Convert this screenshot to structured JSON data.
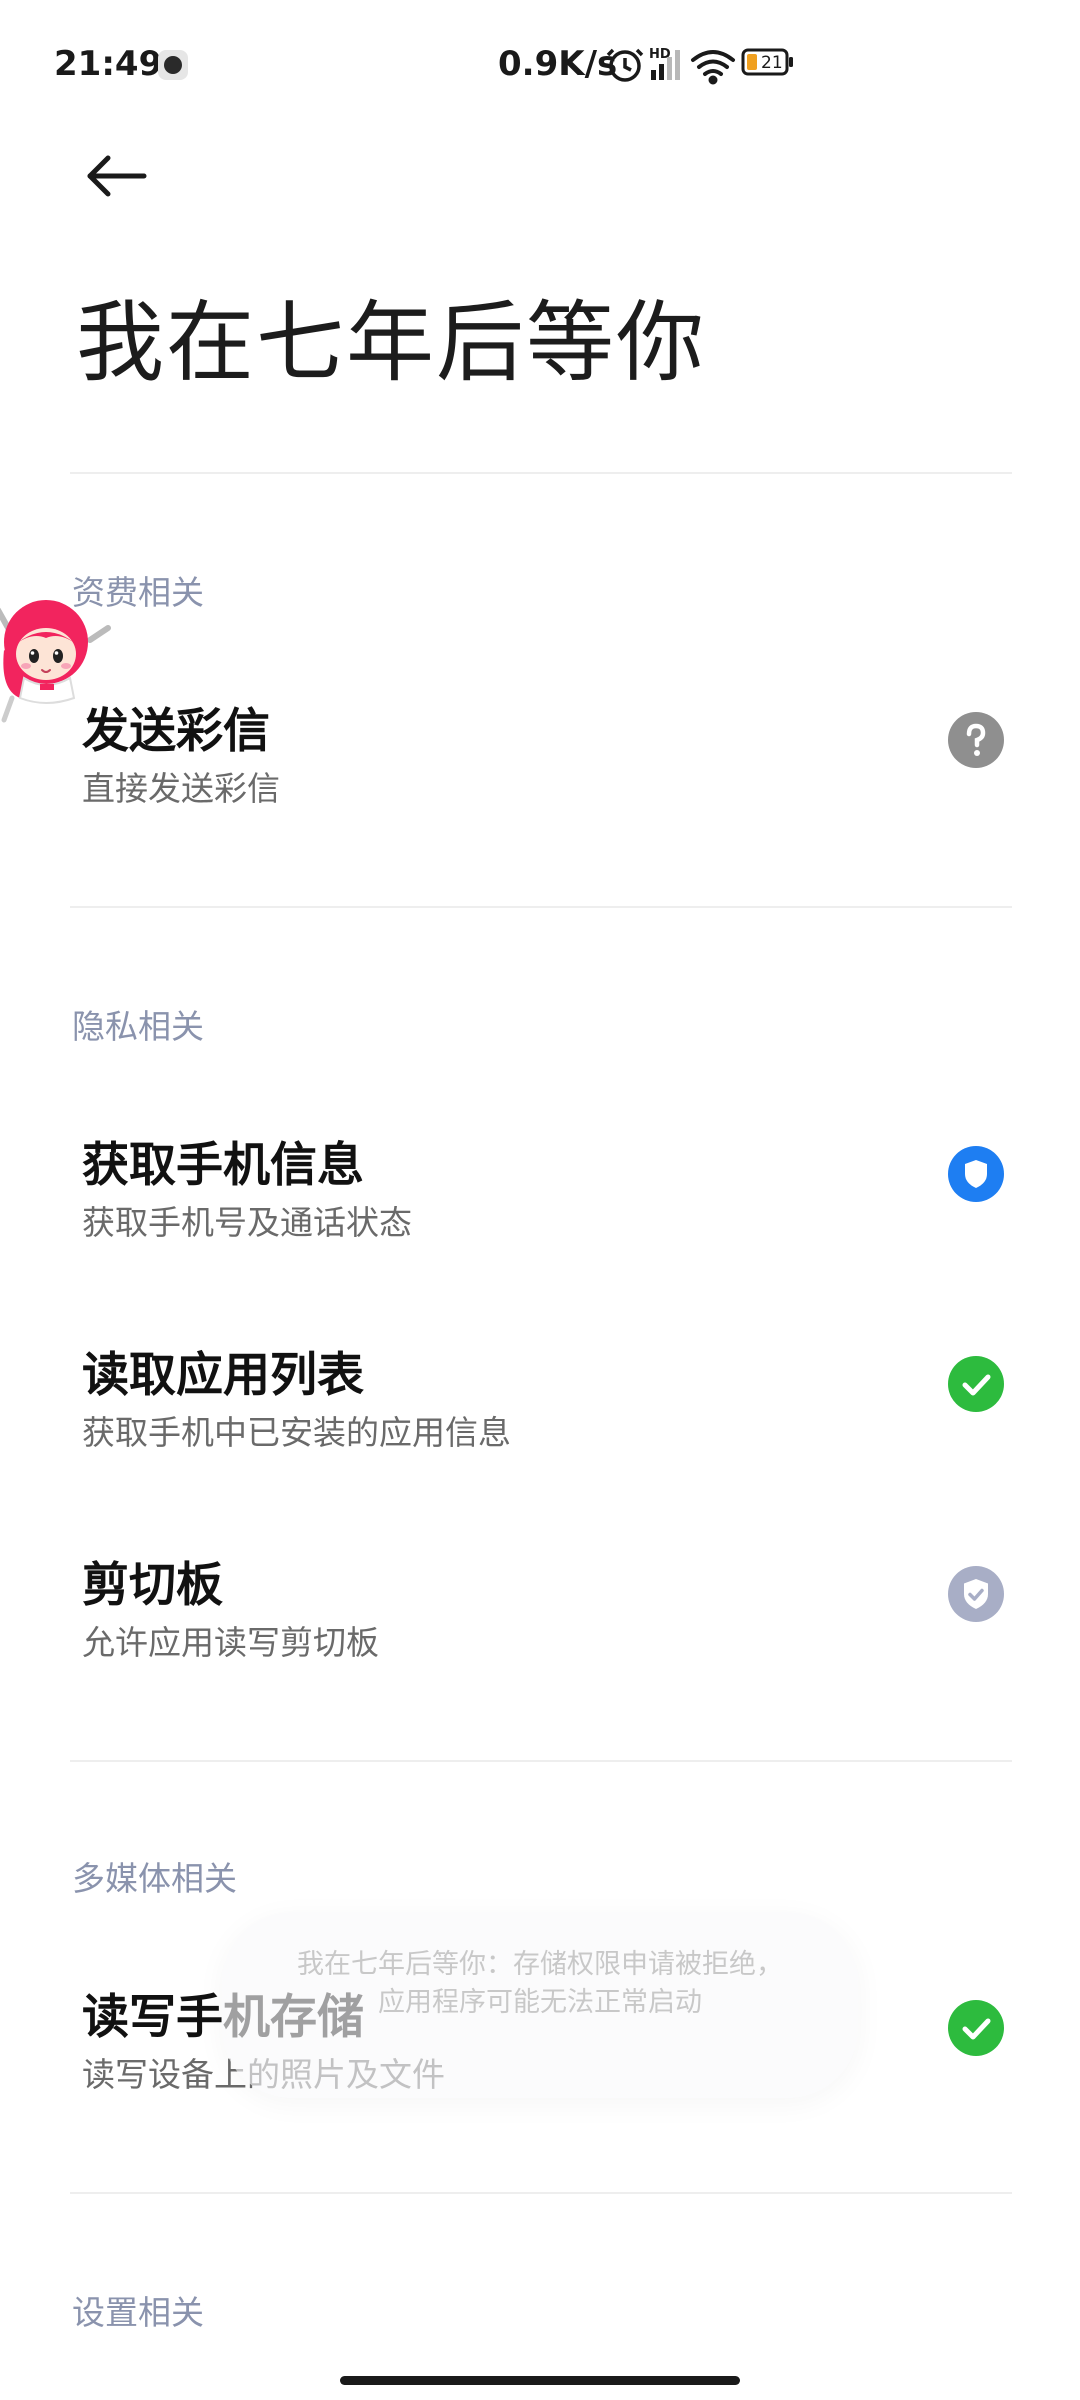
{
  "status_bar": {
    "time": "21:49",
    "net_speed": "0.9K/s",
    "hd_label": "HD",
    "battery": "21"
  },
  "page": {
    "title": "我在七年后等你"
  },
  "sections": [
    {
      "header": "资费相关",
      "items": [
        {
          "title": "发送彩信",
          "desc": "直接发送彩信",
          "status_icon": "question-icon",
          "status_color": "#8f8f8f"
        }
      ]
    },
    {
      "header": "隐私相关",
      "items": [
        {
          "title": "获取手机信息",
          "desc": "获取手机号及通话状态",
          "status_icon": "shield-icon",
          "status_color": "#1e7ef2"
        },
        {
          "title": "读取应用列表",
          "desc": "获取手机中已安装的应用信息",
          "status_icon": "check-icon",
          "status_color": "#2dbb3e"
        },
        {
          "title": "剪切板",
          "desc": "允许应用读写剪切板",
          "status_icon": "shield-check-icon",
          "status_color": "#a8aec6"
        }
      ]
    },
    {
      "header": "多媒体相关",
      "items": [
        {
          "title": "读写手机存储",
          "desc": "读写设备上的照片及文件",
          "status_icon": "check-icon",
          "status_color": "#2dbb3e"
        }
      ]
    },
    {
      "header": "设置相关",
      "items": []
    }
  ],
  "toast": {
    "line1": "我在七年后等你：存储权限申请被拒绝，",
    "line2": "应用程序可能无法正常启动"
  }
}
